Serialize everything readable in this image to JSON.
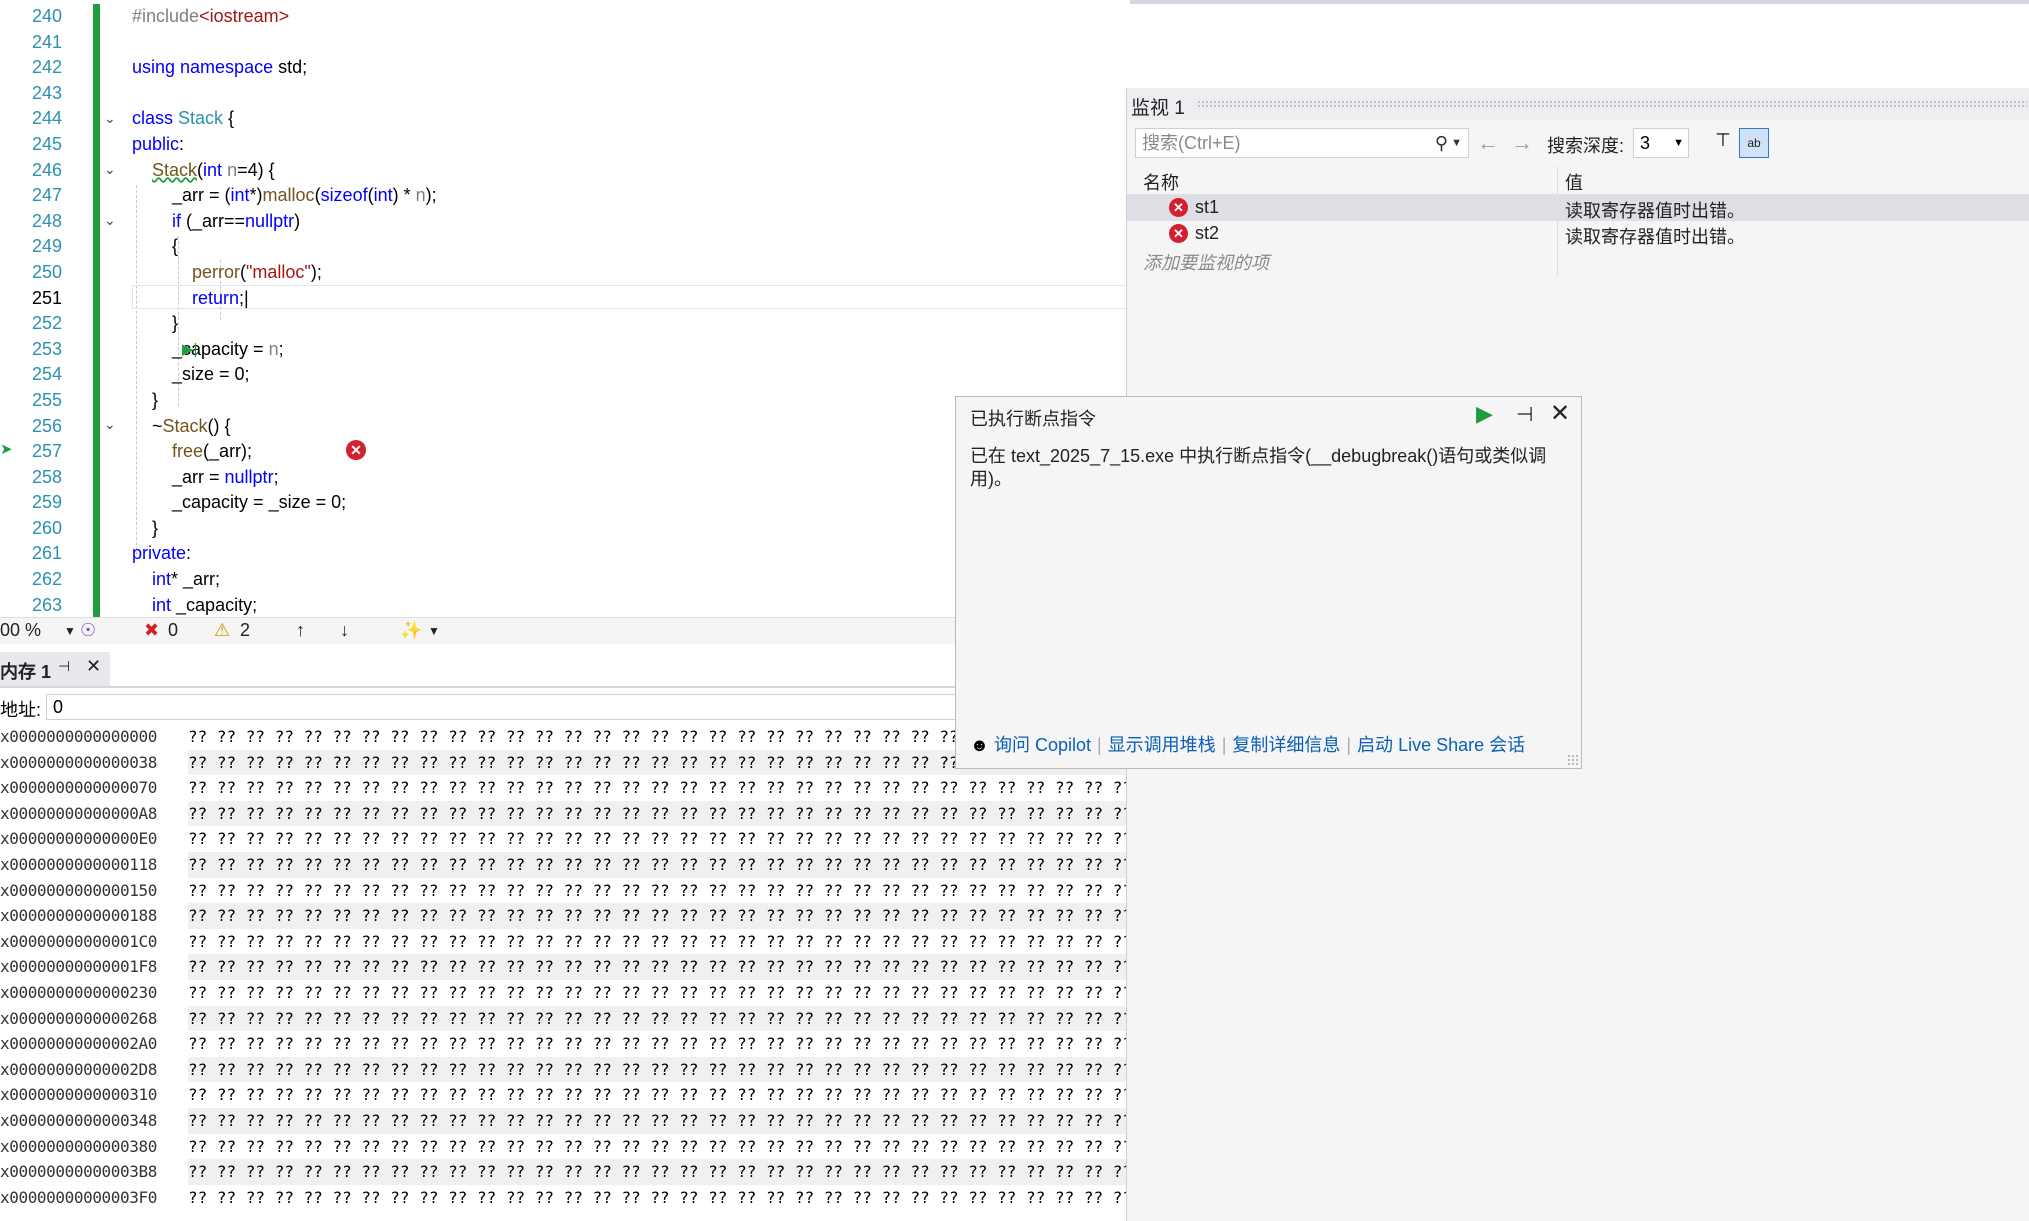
{
  "editor": {
    "line_numbers": [
      "240",
      "241",
      "242",
      "243",
      "244",
      "245",
      "246",
      "247",
      "248",
      "249",
      "250",
      "251",
      "252",
      "253",
      "254",
      "255",
      "256",
      "257",
      "258",
      "259",
      "260",
      "261",
      "262",
      "263"
    ],
    "current_line": "251"
  },
  "status": {
    "zoom": "00 %",
    "errors": "0",
    "warnings": "2"
  },
  "memory": {
    "tab_label": "内存 1",
    "address_label": "地址:",
    "address_value": "0",
    "byte_fill": "?? ?? ?? ?? ?? ?? ?? ?? ?? ?? ?? ?? ?? ?? ?? ?? ?? ?? ?? ?? ?? ?? ?? ?? ?? ?? ?? ?? ?? ?? ?? ?? ?? ?? ?? ?? ?? ?? ?? ?? ?? ??",
    "rows": [
      "x0000000000000000",
      "x0000000000000038",
      "x0000000000000070",
      "x00000000000000A8",
      "x00000000000000E0",
      "x0000000000000118",
      "x0000000000000150",
      "x0000000000000188",
      "x00000000000001C0",
      "x00000000000001F8",
      "x0000000000000230",
      "x0000000000000268",
      "x00000000000002A0",
      "x00000000000002D8",
      "x0000000000000310",
      "x0000000000000348",
      "x0000000000000380",
      "x00000000000003B8",
      "x00000000000003F0"
    ]
  },
  "watch": {
    "title": "监视 1",
    "search_placeholder": "搜索(Ctrl+E)",
    "depth_label": "搜索深度:",
    "depth_value": "3",
    "col_name": "名称",
    "col_value": "值",
    "rows": [
      {
        "name": "st1",
        "value": "读取寄存器值时出错。"
      },
      {
        "name": "st2",
        "value": "读取寄存器值时出错。"
      }
    ],
    "add_hint": "添加要监视的项"
  },
  "exception": {
    "title": "已执行断点指令",
    "message": "已在 text_2025_7_15.exe 中执行断点指令(__debugbreak()语句或类似调用)。",
    "link_copilot": "询问 Copilot",
    "link_callstack": "显示调用堆栈",
    "link_copy": "复制详细信息",
    "link_liveshare": "启动 Live Share 会话"
  }
}
